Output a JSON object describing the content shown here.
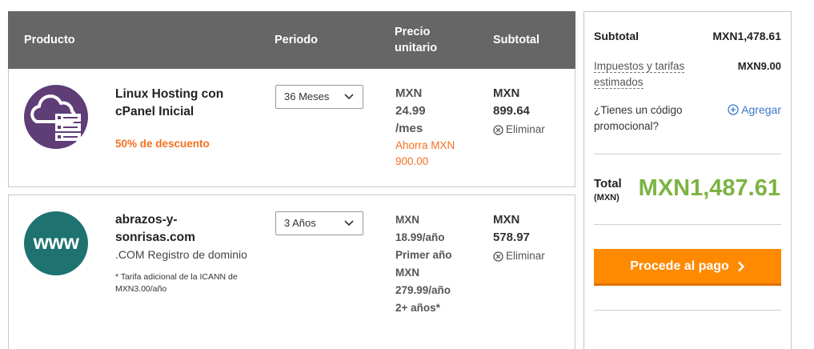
{
  "cart": {
    "headers": {
      "product": "Producto",
      "period": "Periodo",
      "unit_price": "Precio unitario",
      "subtotal": "Subtotal"
    },
    "items": [
      {
        "icon": "hosting-server-cloud-icon",
        "name": "Linux Hosting con cPanel Inicial",
        "discount": "50% de descuento",
        "period": "36 Meses",
        "price_lines": [
          "MXN",
          "24.99",
          "/mes"
        ],
        "savings": "Ahorra MXN 900.00",
        "subtotal_lines": [
          "MXN",
          "899.64"
        ],
        "remove_label": "Eliminar"
      },
      {
        "icon": "www-icon",
        "icon_text": "www",
        "name": "abrazos-y-sonrisas.com",
        "description": ".COM Registro de dominio",
        "note": "* Tarifa adicional de la ICANN de MXN3.00/año",
        "period": "3 Años",
        "price_lines": [
          "MXN",
          "18.99/año",
          "Primer año",
          "MXN",
          "279.99/año",
          "2+ años*"
        ],
        "subtotal_lines": [
          "MXN",
          "578.97"
        ],
        "remove_label": "Eliminar"
      }
    ]
  },
  "summary": {
    "subtotal_label": "Subtotal",
    "subtotal_value": "MXN1,478.61",
    "taxes_label": "Impuestos y tarifas estimados",
    "taxes_value": "MXN9.00",
    "promo_label": "¿Tienes un código promocional?",
    "promo_add": "Agregar",
    "total_label": "Total",
    "total_currency": "(MXN)",
    "total_value": "MXN1,487.61",
    "checkout_label": "Procede al pago"
  },
  "colors": {
    "header_bg": "#666666",
    "accent_orange": "#ff8a00",
    "discount_orange": "#f37021",
    "total_green": "#7cb342",
    "link_blue": "#3a77c8",
    "hosting_purple": "#5f3d77",
    "domain_teal": "#1e7370"
  }
}
